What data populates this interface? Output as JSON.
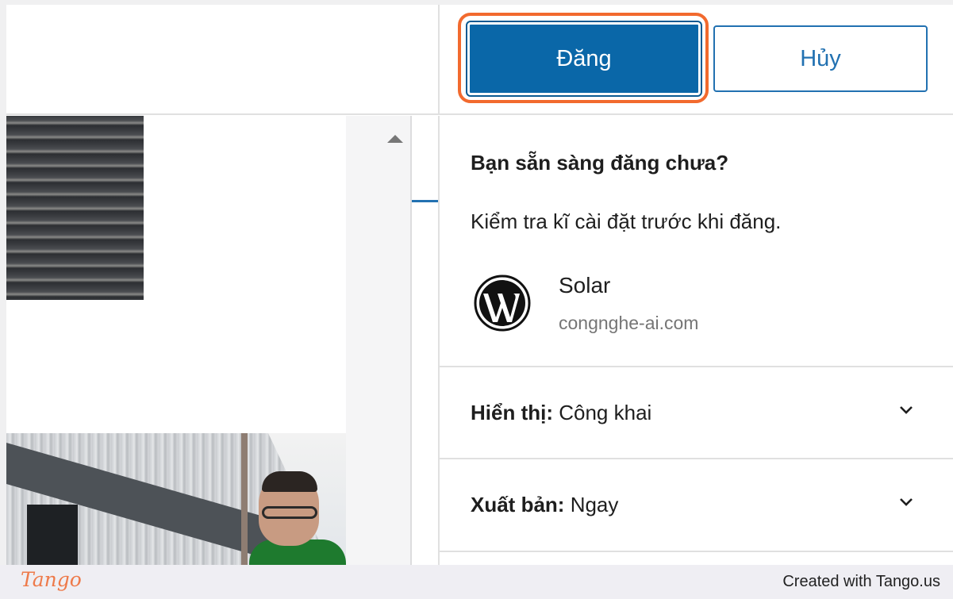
{
  "toolbar": {
    "publish_label": "Đăng",
    "cancel_label": "Hủy"
  },
  "publish_panel": {
    "title": "Bạn sẵn sàng đăng chưa?",
    "description": "Kiểm tra kĩ cài đặt trước khi đăng.",
    "site": {
      "name": "Solar",
      "url": "congnghe-ai.com",
      "icon": "wordpress-icon"
    },
    "visibility": {
      "label": "Hiển thị:",
      "value": "Công khai"
    },
    "publish_time": {
      "label": "Xuất bản:",
      "value": "Ngay"
    }
  },
  "footer": {
    "logo": "Tango",
    "credit": "Created with Tango.us"
  },
  "colors": {
    "primary": "#0a67a8",
    "highlight": "#f26a2e",
    "link": "#2271b1"
  }
}
